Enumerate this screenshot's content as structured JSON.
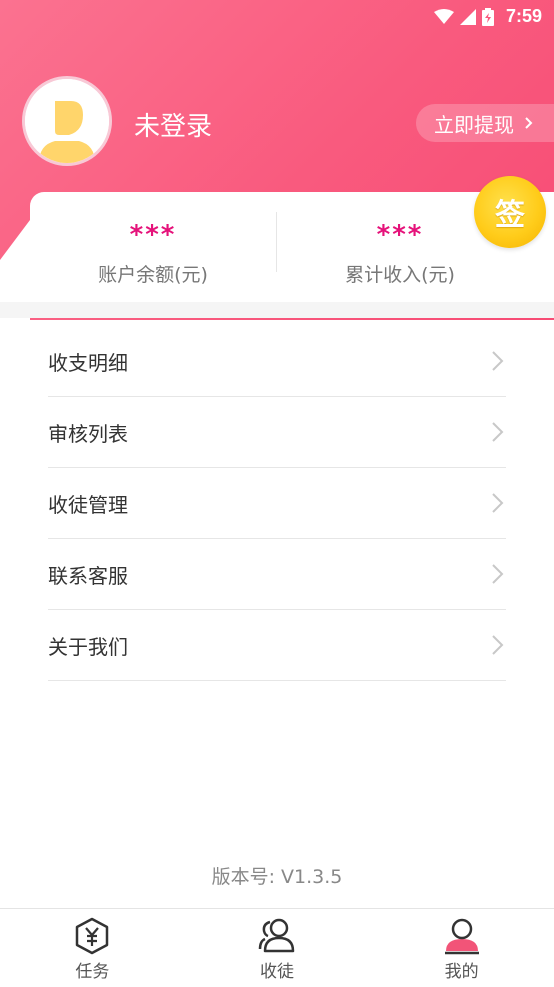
{
  "status_bar": {
    "time": "7:59"
  },
  "profile": {
    "username": "未登录",
    "withdraw_label": "立即提现"
  },
  "stats": [
    {
      "value": "***",
      "label": "账户余额(元)"
    },
    {
      "value": "***",
      "label": "累计收入(元)"
    }
  ],
  "sign_badge": {
    "label": "签"
  },
  "menu": {
    "items": [
      {
        "label": "收支明细"
      },
      {
        "label": "审核列表"
      },
      {
        "label": "收徒管理"
      },
      {
        "label": "联系客服"
      },
      {
        "label": "关于我们"
      }
    ]
  },
  "version": "版本号: V1.3.5",
  "tabs": [
    {
      "label": "任务",
      "icon": "yen-hexagon-icon"
    },
    {
      "label": "收徒",
      "icon": "users-icon"
    },
    {
      "label": "我的",
      "icon": "profile-icon",
      "active": true
    }
  ],
  "colors": {
    "header_pink": "#f95a7e",
    "stat_value": "#e5127a",
    "badge_gold": "#ffcc1a",
    "active_tab": "#f25478"
  }
}
